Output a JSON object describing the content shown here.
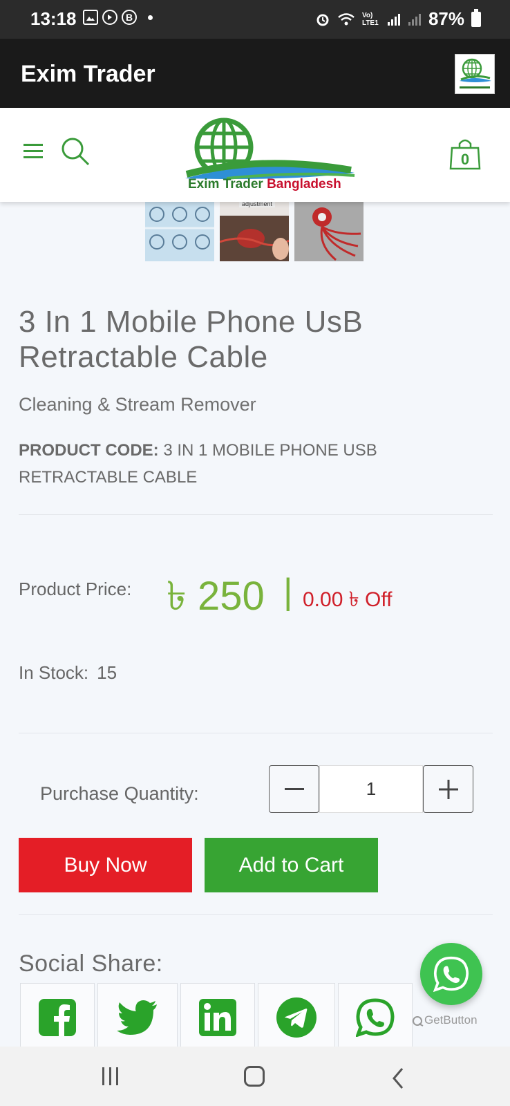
{
  "status_bar": {
    "time": "13:18",
    "battery": "87%",
    "icons": [
      "gallery-icon",
      "play-icon",
      "b-icon",
      "alarm-icon",
      "wifi-icon",
      "volte-icon",
      "signal-icon",
      "signal-icon",
      "battery-icon"
    ],
    "b_glyph": "B",
    "volte_text": "Vo) LTE1"
  },
  "app_bar": {
    "title": "Exim Trader"
  },
  "header": {
    "brand_part1": "Exim Trader ",
    "brand_part2": "Bangladesh",
    "cart_count": "0"
  },
  "gallery": {
    "thumb2_caption": "adjustment"
  },
  "product": {
    "title": "3 In 1 Mobile Phone UsB Retractable Cable",
    "subtitle": "Cleaning & Stream Remover",
    "code_label": "PRODUCT CODE:",
    "code_value": "3 IN 1 MOBILE PHONE USB RETRACTABLE CABLE",
    "price_label": "Product Price:",
    "price": "৳ 250",
    "price_separator": "|",
    "discount": "0.00 ৳ Off",
    "stock_label": "In Stock:",
    "stock_value": "15"
  },
  "purchase": {
    "quantity_label": "Purchase Quantity:",
    "quantity_value": "1",
    "buy_now_label": "Buy Now",
    "add_to_cart_label": "Add to Cart"
  },
  "social": {
    "title": "Social Share:",
    "networks": [
      "facebook",
      "twitter",
      "linkedin",
      "telegram",
      "whatsapp"
    ]
  },
  "floating": {
    "getbutton_text": "GetButton"
  },
  "colors": {
    "brand_green": "#37a433",
    "price_green": "#79b33c",
    "buy_red": "#e41e26",
    "whatsapp_green": "#3fc351",
    "dark_bar": "#1a1a1a"
  }
}
